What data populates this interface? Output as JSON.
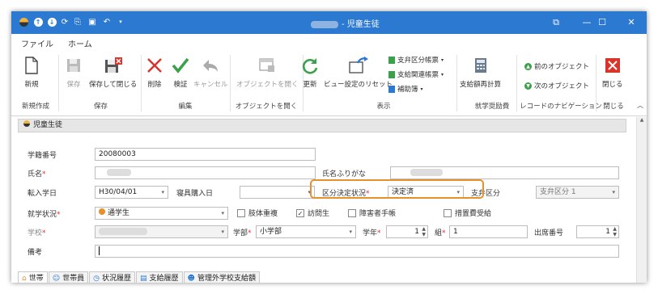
{
  "window": {
    "title": "- 児童生徒",
    "minimize": "—",
    "maximize": "☐",
    "close": "✕",
    "restore": "⧉"
  },
  "menu": {
    "file": "ファイル",
    "home": "ホーム"
  },
  "ribbon": {
    "new": "新規",
    "save": "保存",
    "save_close": "保存して閉じる",
    "delete": "削除",
    "validate": "検証",
    "cancel": "キャンセル",
    "open_object": "オブジェクトを開く",
    "refresh": "更新",
    "reset_view": "ビュー設定のリセット",
    "pay_category_ledger": "支弁区分帳票",
    "pay_related_ledger": "支給関連帳票",
    "aid_book": "補助簿",
    "pay_recalc": "支給額再計算",
    "prev_object": "前のオブジェクト",
    "next_object": "次のオブジェクト",
    "close": "閉じる",
    "groups": {
      "new": "新規作成",
      "save": "保存",
      "edit": "編集",
      "open": "オブジェクトを開く",
      "display": "表示",
      "aid": "就学奨励費",
      "nav": "レコードのナビゲーション",
      "close": "閉じる"
    }
  },
  "form": {
    "panel_title": "児童生徒",
    "student_no_label": "学籍番号",
    "student_no": "20080003",
    "name_label": "氏名",
    "kana_label": "氏名ふりがな",
    "transfer_label": "転入学日",
    "transfer_date": "H30/04/01",
    "dorm_label": "寝具購入日",
    "decision_label": "区分決定状況",
    "decision_value": "決定済",
    "pay_cat_label": "支弁区分",
    "pay_cat_value": "支弁区分 1",
    "study_label": "就学状況",
    "study_value": "通学生",
    "chk_multi": "肢体重複",
    "chk_visit": "訪問生",
    "chk_disability": "障害者手帳",
    "chk_measure": "措置費受給",
    "school_label": "学校",
    "dept_label": "学部",
    "dept_value": "小学部",
    "grade_label": "学年",
    "grade_value": "1",
    "class_label": "組",
    "class_value": "1",
    "attend_label": "出席番号",
    "attend_value": "1",
    "note_label": "備考"
  },
  "tabs": [
    "世帯",
    "世帯員",
    "状況履歴",
    "支給履歴",
    "管理外学校支給額"
  ],
  "colors": {
    "title_bar": "#2b79d0",
    "highlight": "#e8902b",
    "required": "#d9342b"
  }
}
